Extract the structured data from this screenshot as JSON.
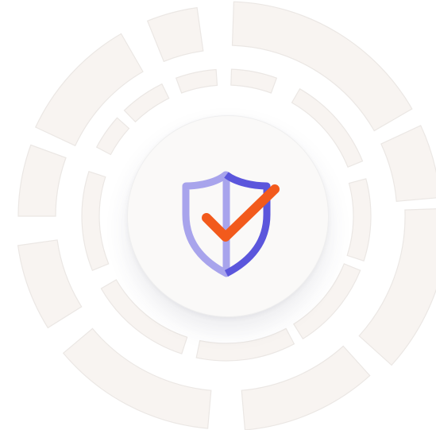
{
  "colors": {
    "background": "#ffffff",
    "segment_fill": "#f8f4f1",
    "segment_outline": "#ebe7e4",
    "disc_fill": "#faf9f8",
    "shield_left": "#a8a4ec",
    "shield_right": "#5b56dc",
    "check": "#f25a1c"
  },
  "icons": {
    "center": "shield-check-icon"
  }
}
